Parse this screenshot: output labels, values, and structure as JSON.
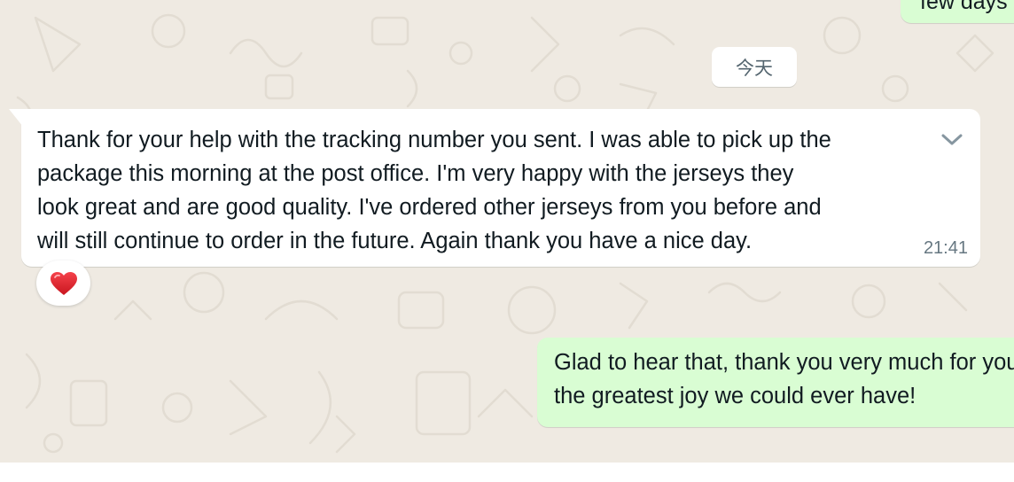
{
  "conversation": {
    "previous_message": {
      "text_fragment": "few days"
    },
    "date_divider": {
      "label": "今天"
    },
    "incoming_message": {
      "lines": [
        "Thank for your help with the tracking number you sent. I was able to pick up the",
        "package this morning at the post office. I'm very happy with the jerseys they",
        "look great and are good quality. I've ordered other jerseys from you before and",
        "will still continue to order in the future. Again thank you have a nice day."
      ],
      "time": "21:41",
      "menu_icon": "chevron-down-icon",
      "reaction": {
        "emoji": "heart",
        "color": "#e0242f"
      }
    },
    "outgoing_message": {
      "lines": [
        "Glad to hear that, thank you very much for your support,",
        "the greatest joy we could ever have!"
      ]
    }
  },
  "colors": {
    "chat_background": "#efeae2",
    "incoming_bubble": "#ffffff",
    "outgoing_bubble": "#d9fdd3",
    "primary_text": "#111b21",
    "secondary_text": "#667781"
  }
}
